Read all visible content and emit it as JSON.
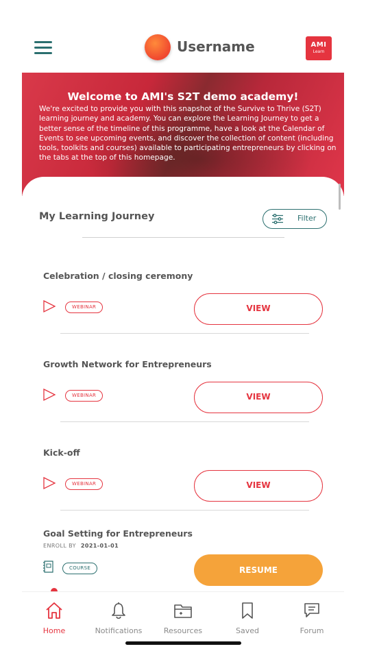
{
  "header": {
    "username": "Username",
    "logo_line1": "AMI",
    "logo_line2": "Learn"
  },
  "banner": {
    "title": "Welcome to AMI's S2T demo academy!",
    "text": "We're excited to provide you with this snapshot of the Survive to Thrive (S2T) learning journey and academy. You can explore the Learning Journey to get a better sense of the timeline of this programme, have a look at the Calendar of Events to see upcoming events, and discover the collection of content (including tools, toolkits and courses) available to participating entrepreneurs by clicking on the tabs at the top of this homepage."
  },
  "journey": {
    "title": "My Learning Journey",
    "filter_label": "Filter",
    "items": [
      {
        "title": "Celebration / closing ceremony",
        "tag": "WEBINAR",
        "action": "VIEW"
      },
      {
        "title": "Growth Network for Entrepreneurs",
        "tag": "WEBINAR",
        "action": "VIEW"
      },
      {
        "title": "Kick-off",
        "tag": "WEBINAR",
        "action": "VIEW"
      },
      {
        "title": "Goal Setting for Entrepreneurs",
        "enroll_label": "ENROLL BY",
        "enroll_date": "2021-01-01",
        "tag": "COURSE",
        "action": "RESUME"
      }
    ]
  },
  "tabs": [
    {
      "label": "Home",
      "icon": "home-icon",
      "active": true
    },
    {
      "label": "Notifications",
      "icon": "bell-icon"
    },
    {
      "label": "Resources",
      "icon": "folder-icon"
    },
    {
      "label": "Saved",
      "icon": "bookmark-icon"
    },
    {
      "label": "Forum",
      "icon": "chat-icon"
    }
  ],
  "colors": {
    "accent": "#e5343f",
    "teal": "#2b6f6f",
    "resume": "#f5a33a"
  }
}
